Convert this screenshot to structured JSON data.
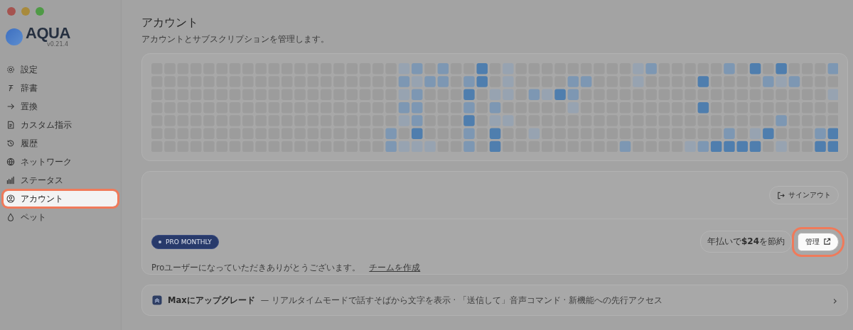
{
  "app": {
    "name": "AQUA",
    "version": "v0.21.4"
  },
  "sidebar": {
    "items": [
      {
        "label": "設定",
        "selected": false
      },
      {
        "label": "辞書",
        "selected": false
      },
      {
        "label": "置換",
        "selected": false
      },
      {
        "label": "カスタム指示",
        "selected": false
      },
      {
        "label": "履歴",
        "selected": false
      },
      {
        "label": "ネットワーク",
        "selected": false
      },
      {
        "label": "ステータス",
        "selected": false
      },
      {
        "label": "アカウント",
        "selected": true
      },
      {
        "label": "ペット",
        "selected": false
      }
    ]
  },
  "page": {
    "title": "アカウント",
    "subtitle": "アカウントとサブスクリプションを管理します。"
  },
  "account": {
    "sign_out": "サインアウト",
    "plan_badge": "PRO MONTHLY",
    "savings": "年払いで**$24**を節約",
    "manage": {
      "label": "管理",
      "highlighted": true
    },
    "thanks": "Proユーザーになっていただきありがとうございます。",
    "team_link": "チームを作成"
  },
  "upgrade": {
    "title": "Maxにアップグレード",
    "description": "— リアルタイムモードで話すそばから文字を表示 · 「送信して」音声コマンド · 新機能への先行アクセス",
    "chevron": "›"
  }
}
